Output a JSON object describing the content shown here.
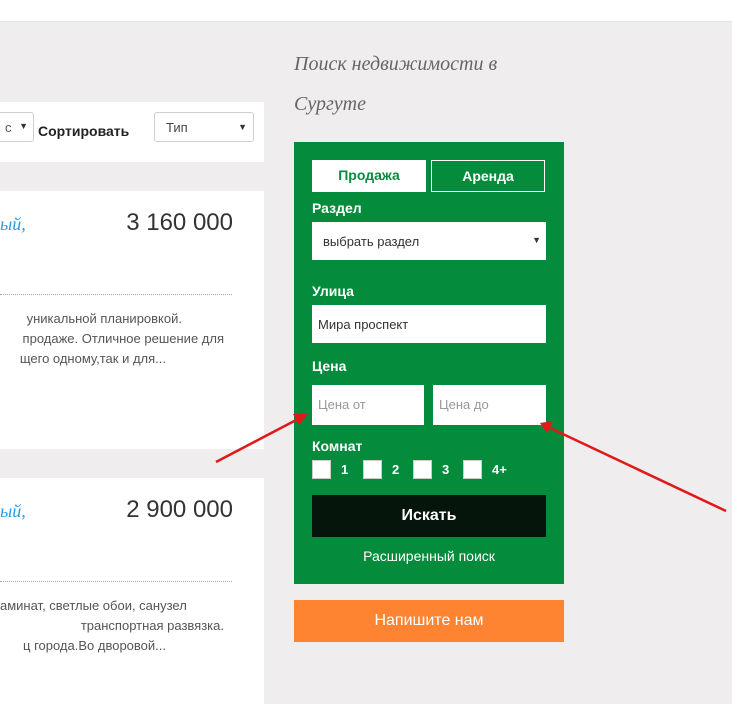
{
  "sort": {
    "left_select_fragment": "с",
    "sort_label": "Сортировать",
    "type_select": "Тип"
  },
  "listings": [
    {
      "title_fragment": "ый,",
      "price": "3 160 000",
      "desc_lines": [
        "уникальной планировкой.",
        "продаже. Отличное решение для",
        "щего одному,так и для..."
      ]
    },
    {
      "title_fragment": "ый,",
      "price": "2 900 000",
      "desc_lines": [
        "аминат, светлые обои, санузел",
        "транспортная развязка.",
        "ц города.Во дворовой..."
      ]
    }
  ],
  "sidebar": {
    "title_line1": "Поиск недвижимости в",
    "title_line2": "Сургуте"
  },
  "search_panel": {
    "tabs": {
      "sale": "Продажа",
      "rent": "Аренда"
    },
    "section_label": "Раздел",
    "section_select": "выбрать раздел",
    "street_label": "Улица",
    "street_value": "Мира проспект",
    "price_label": "Цена",
    "price_from_placeholder": "Цена от",
    "price_to_placeholder": "Цена до",
    "rooms_label": "Комнат",
    "rooms": [
      "1",
      "2",
      "3",
      "4+"
    ],
    "search_button": "Искать",
    "advanced_link": "Расширенный поиск"
  },
  "contact_button": "Напишите нам",
  "colors": {
    "panel_green": "#048b3b",
    "search_button_bg": "#06150b",
    "contact_orange": "#fe8431",
    "link_blue": "#2a9be2",
    "arrow_red": "#e01919"
  },
  "icons": [
    "select-arrow-icon",
    "annotation-arrow-icon"
  ]
}
